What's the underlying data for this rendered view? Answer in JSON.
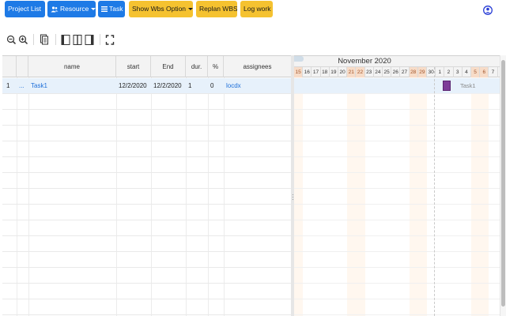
{
  "toolbar": {
    "project_list": "Project List",
    "resource": "Resource",
    "task": "Task",
    "show_wbs_option": "Show Wbs Option",
    "replan_wbs": "Replan WBS",
    "log_work": "Log work"
  },
  "colors": {
    "primary_button": "#1e7ae6",
    "warning_button": "#f5c230",
    "task_bar": "#7d3c98",
    "weekend": "#f7dcc8",
    "selected_row": "#e7f1fb"
  },
  "gantt_tools": [
    "zoom-out-icon",
    "zoom-in-icon",
    "copy-icon",
    "grid-only-icon",
    "split-view-icon",
    "gantt-only-icon",
    "fullscreen-icon"
  ],
  "grid": {
    "columns": [
      "name",
      "start",
      "End",
      "dur.",
      "%",
      "assignees"
    ],
    "rows": [
      {
        "num": "1",
        "expander": "...",
        "name": "Task1",
        "start": "12/2/2020",
        "end": "12/2/2020",
        "dur": "1",
        "pct": "0",
        "assignees": "locdx"
      }
    ]
  },
  "gantt": {
    "month": "November 2020",
    "days": [
      "15",
      "16",
      "17",
      "18",
      "19",
      "20",
      "21",
      "22",
      "23",
      "24",
      "25",
      "26",
      "27",
      "28",
      "29",
      "30",
      "1",
      "2",
      "3",
      "4",
      "5",
      "6",
      "7"
    ],
    "weekend_days": [
      "15",
      "21",
      "22",
      "28",
      "29",
      "5",
      "6"
    ],
    "task_label": "Task1"
  }
}
